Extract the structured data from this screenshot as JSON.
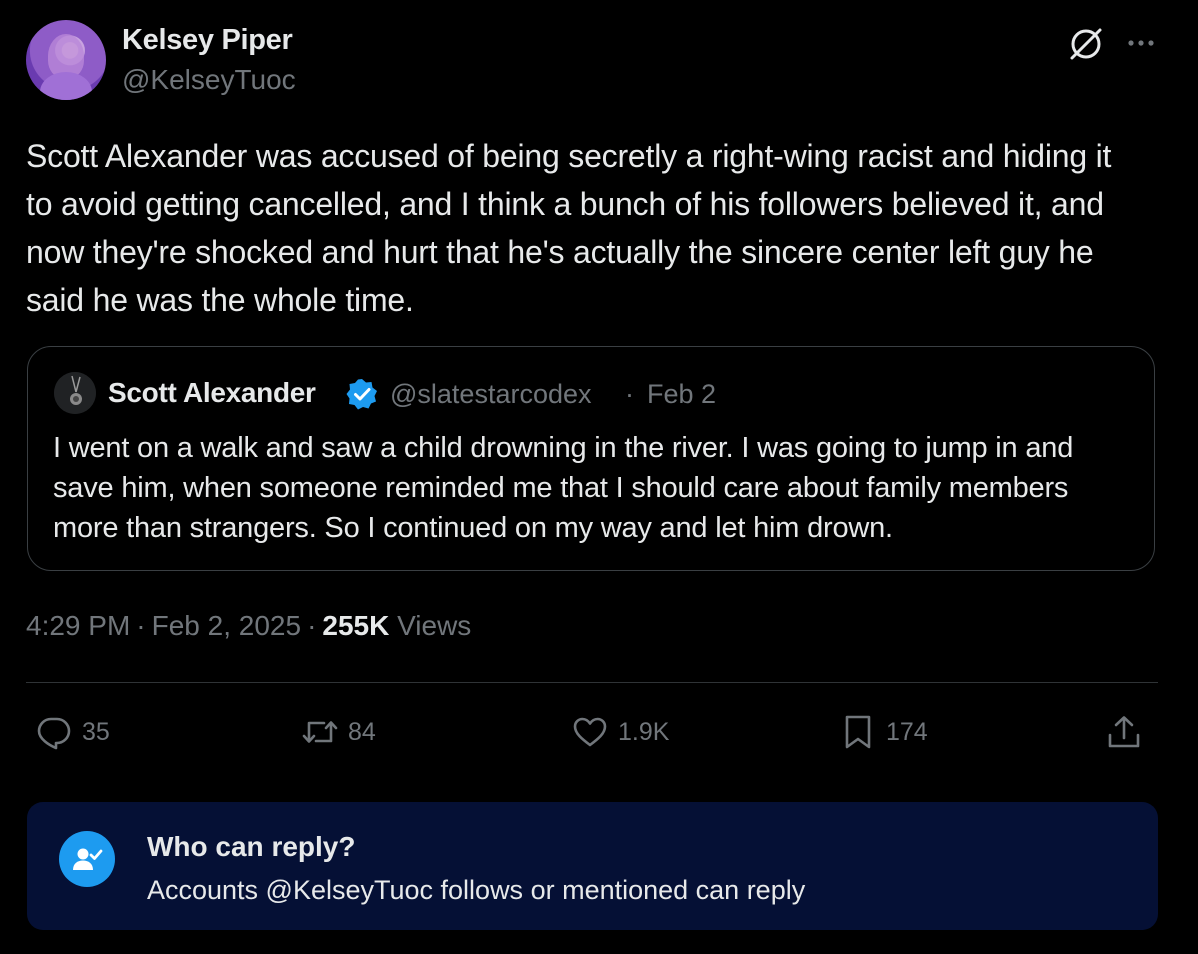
{
  "author": {
    "display_name": "Kelsey Piper",
    "handle": "@KelseyTuoc",
    "avatar": "avatar-photo"
  },
  "header_icons": [
    "grok-icon",
    "more-icon"
  ],
  "tweet": {
    "text": "Scott Alexander was accused of being secretly a right-wing racist and hiding it to avoid getting cancelled, and I think a bunch of his followers believed it, and now they're shocked and hurt that he's actually the sincere center left guy he said he was the whole time."
  },
  "quote": {
    "display_name": "Scott Alexander",
    "verified": true,
    "handle": "@slatestarcodex",
    "separator": "·",
    "date": "Feb 2",
    "text": "I went on a walk and saw a child drowning in the river. I was going to jump in and save him, when someone reminded me that I should care about family members more than strangers. So I continued on my way and let him drown."
  },
  "meta": {
    "time": "4:29 PM",
    "date": "Feb 2, 2025",
    "views_count": "255K",
    "views_label": "Views",
    "separator": "·"
  },
  "actions": {
    "replies": "35",
    "reposts": "84",
    "likes": "1.9K",
    "bookmarks": "174"
  },
  "who_can_reply": {
    "title": "Who can reply?",
    "description": "Accounts @KelseyTuoc follows or mentioned can reply"
  },
  "colors": {
    "background": "#000000",
    "text_primary": "#e7e9ea",
    "text_secondary": "#71767b",
    "accent_blue": "#1d9bf0",
    "reply_box_bg": "#051035",
    "border": "#2f3336"
  }
}
